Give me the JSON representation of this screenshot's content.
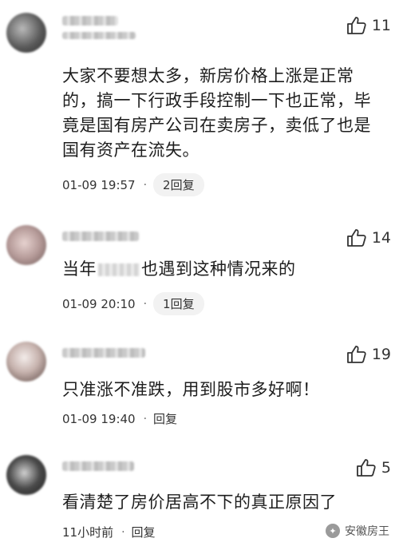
{
  "comments": [
    {
      "likes": "11",
      "text": "大家不要想太多，新房价格上涨是正常的，搞一下行政手段控制一下也正常，毕竟是国有房产公司在卖房子，卖低了也是国有资产在流失。",
      "time": "01-09 19:57",
      "reply": "2回复"
    },
    {
      "likes": "14",
      "text_before": "当年",
      "text_after": "也遇到这种情况来的",
      "time": "01-09 20:10",
      "reply": "1回复"
    },
    {
      "likes": "19",
      "text": "只准涨不准跌，用到股市多好啊！",
      "time": "01-09 19:40",
      "reply": "回复"
    },
    {
      "likes": "5",
      "text": "看清楚了房价居高不下的真正原因了",
      "time": "11小时前",
      "reply": "回复"
    }
  ],
  "watermark": {
    "label": "安徽房王",
    "icon": "wechat-icon"
  }
}
